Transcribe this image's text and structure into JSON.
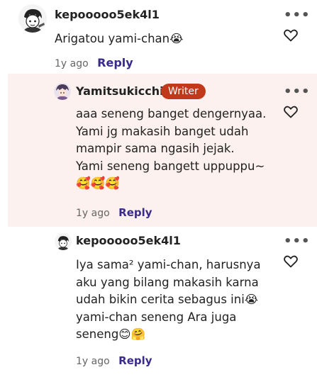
{
  "colors": {
    "reply_link": "#3a2a8c",
    "writer_badge": "#c0391b",
    "writer_bg": "#fcf1ee",
    "text": "#222222",
    "meta": "#666666"
  },
  "comments": [
    {
      "username": "kepooooo5ek4l1",
      "text": "Arigatou yami-chan😭",
      "time": "1y ago",
      "reply_label": "Reply",
      "more_label": "•••",
      "like_icon": "heart-outline-icon"
    },
    {
      "username": "Yamitsukicchi",
      "badge": "Writer",
      "text": "aaa seneng banget dengernyaa.\nYami jg makasih banget udah\nmampir sama ngasih jejak.\nYami seneng bangett uppuppu~\n🥰🥰🥰",
      "time": "1y ago",
      "reply_label": "Reply",
      "more_label": "•••",
      "like_icon": "heart-outline-icon"
    },
    {
      "username": "kepooooo5ek4l1",
      "text": "Iya sama² yami-chan, harusnya\naku yang bilang makasih karna\nudah bikin cerita sebagus ini😭\nyami-chan seneng Ara juga\nseneng😊🤗",
      "time": "1y ago",
      "reply_label": "Reply",
      "more_label": "•••",
      "like_icon": "heart-outline-icon"
    }
  ]
}
